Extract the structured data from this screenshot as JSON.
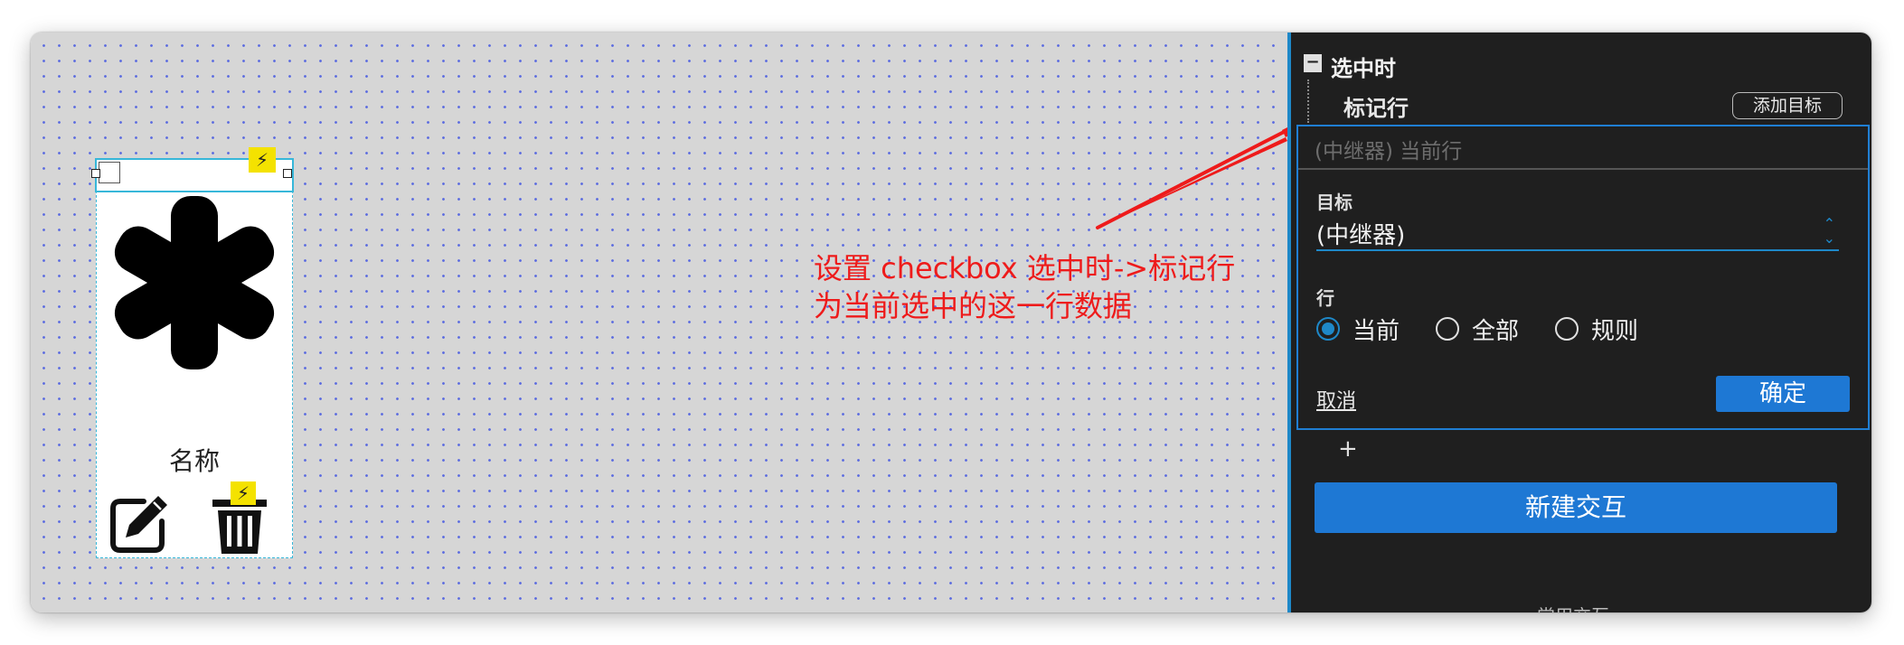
{
  "canvas": {
    "widget": {
      "name_label": "名称",
      "icons": [
        "asterisk-icon",
        "edit-icon",
        "trash-icon",
        "lightning-icon"
      ]
    },
    "annotation": {
      "line1": "设置 checkbox 选中时->标记行",
      "line2": "为当前选中的这一行数据",
      "color": "#ee1b1b"
    }
  },
  "panel": {
    "event_title": "选中时",
    "collapse_symbol": "−",
    "action_title": "标记行",
    "add_target_label": "添加目标",
    "editor": {
      "summary_placeholder": "(中继器) 当前行",
      "target_label": "目标",
      "target_value": "(中继器)",
      "row_label": "行",
      "row_options": [
        {
          "label": "当前",
          "checked": true
        },
        {
          "label": "全部",
          "checked": false
        },
        {
          "label": "规则",
          "checked": false
        }
      ],
      "cancel_label": "取消",
      "confirm_label": "确定"
    },
    "plus_label": "+",
    "new_interaction_label": "新建交互",
    "cutoff_label": "常用交互",
    "accent": "#1e88c8",
    "button_color": "#1e78d4"
  }
}
